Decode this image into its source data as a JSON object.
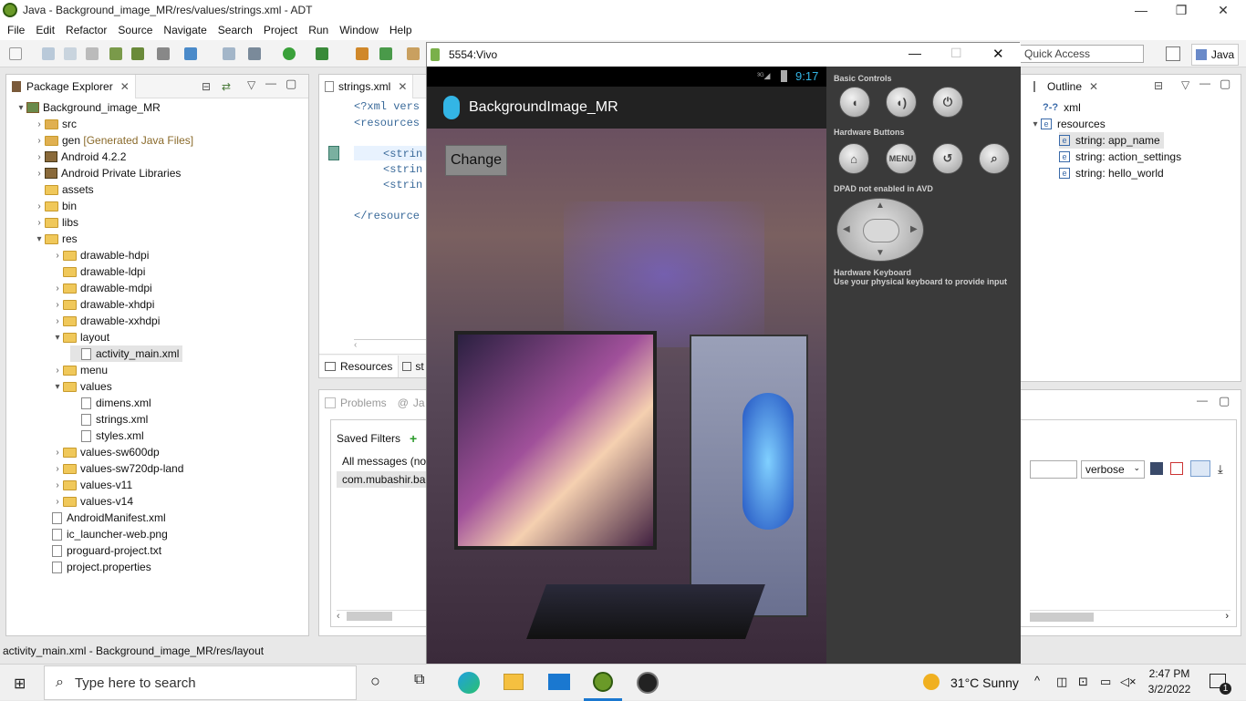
{
  "window": {
    "title": "Java - Background_image_MR/res/values/strings.xml - ADT"
  },
  "menu": [
    "File",
    "Edit",
    "Refactor",
    "Source",
    "Navigate",
    "Search",
    "Project",
    "Run",
    "Window",
    "Help"
  ],
  "toolbar": {
    "quick_access_placeholder": "Quick Access",
    "perspective": "Java"
  },
  "package_explorer": {
    "title": "Package Explorer",
    "project": "Background_image_MR",
    "items": [
      {
        "label": "src"
      },
      {
        "label": "gen",
        "extra": "[Generated Java Files]"
      },
      {
        "label": "Android 4.2.2"
      },
      {
        "label": "Android Private Libraries"
      },
      {
        "label": "assets"
      },
      {
        "label": "bin"
      },
      {
        "label": "libs"
      },
      {
        "label": "res"
      },
      {
        "label": "drawable-hdpi"
      },
      {
        "label": "drawable-ldpi"
      },
      {
        "label": "drawable-mdpi"
      },
      {
        "label": "drawable-xhdpi"
      },
      {
        "label": "drawable-xxhdpi"
      },
      {
        "label": "layout"
      },
      {
        "label": "activity_main.xml"
      },
      {
        "label": "menu"
      },
      {
        "label": "values"
      },
      {
        "label": "dimens.xml"
      },
      {
        "label": "strings.xml"
      },
      {
        "label": "styles.xml"
      },
      {
        "label": "values-sw600dp"
      },
      {
        "label": "values-sw720dp-land"
      },
      {
        "label": "values-v11"
      },
      {
        "label": "values-v14"
      },
      {
        "label": "AndroidManifest.xml"
      },
      {
        "label": "ic_launcher-web.png"
      },
      {
        "label": "proguard-project.txt"
      },
      {
        "label": "project.properties"
      }
    ]
  },
  "editor": {
    "tab": "strings.xml",
    "lines": [
      "<?xml vers",
      "<resources",
      "",
      "<strin",
      "<strin",
      "<strin",
      "",
      "</resource"
    ],
    "bottom_tabs": [
      "Resources",
      "st"
    ]
  },
  "console": {
    "tabs": [
      "Problems",
      "Ja"
    ],
    "saved_filters": "Saved Filters",
    "rows": [
      "All messages (no f",
      "com.mubashir.ba"
    ],
    "level": "verbose"
  },
  "emulator": {
    "title": "5554:Vivo",
    "clock": "9:17",
    "app_title": "BackgroundImage_MR",
    "button": "Change",
    "sections": {
      "basic": "Basic Controls",
      "hardware": "Hardware Buttons",
      "dpad": "DPAD not enabled in AVD",
      "keyboard": "Hardware Keyboard",
      "keyboard_hint": "Use your physical keyboard to provide input"
    },
    "menu_btn": "MENU"
  },
  "outline": {
    "title": "Outline",
    "items": [
      "xml",
      "resources",
      "string: app_name",
      "string: action_settings",
      "string: hello_world"
    ]
  },
  "status_bar": "activity_main.xml - Background_image_MR/res/layout",
  "taskbar": {
    "search_placeholder": "Type here to search",
    "weather": "31°C  Sunny",
    "time": "2:47 PM",
    "date": "3/2/2022",
    "notifications": "1"
  }
}
